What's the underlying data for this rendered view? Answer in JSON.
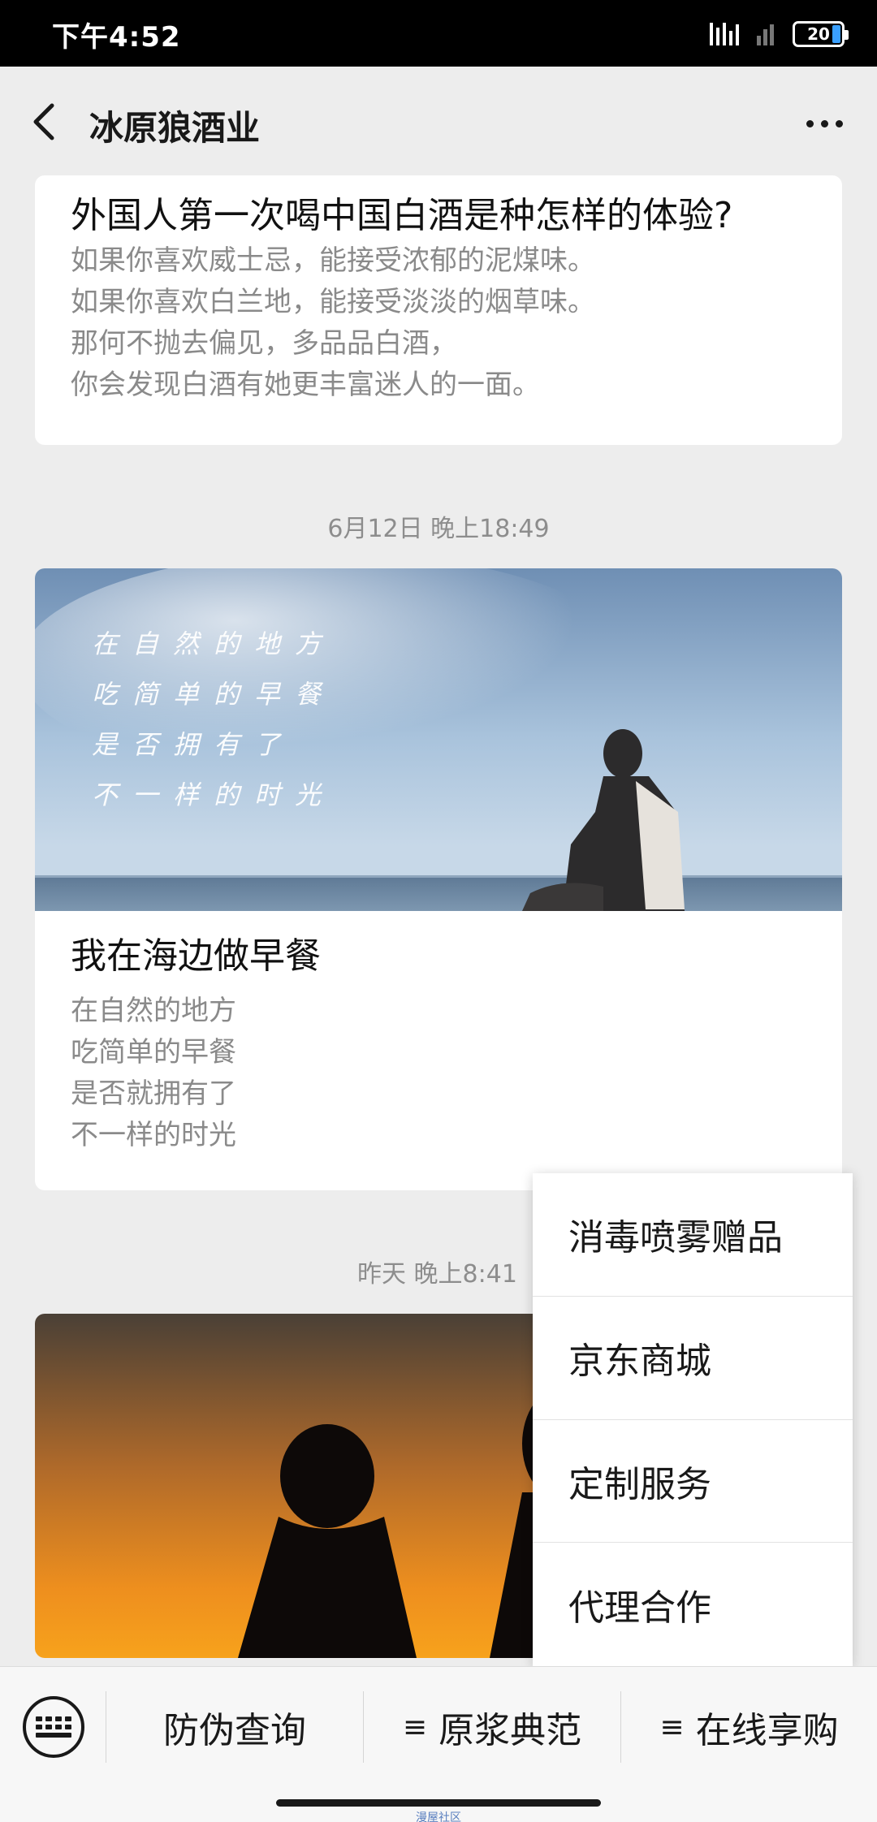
{
  "status_bar": {
    "time": "下午4:52",
    "battery": "20"
  },
  "header": {
    "title": "冰原狼酒业"
  },
  "feed": {
    "articles": [
      {
        "title": "外国人第一次喝中国白酒是种怎样的体验?",
        "desc": [
          "如果你喜欢威士忌，能接受浓郁的泥煤味。",
          "如果你喜欢白兰地，能接受淡淡的烟草味。",
          "那何不抛去偏见，多品品白酒，",
          "你会发现白酒有她更丰富迷人的一面。"
        ]
      },
      {
        "timestamp": "6月12日 晚上18:49",
        "cover_text": [
          "在自然的地方",
          "吃简单的早餐",
          "是否拥有了",
          "不一样的时光"
        ],
        "title": "我在海边做早餐",
        "desc": [
          "在自然的地方",
          "吃简单的早餐",
          "是否就拥有了",
          "不一样的时光"
        ]
      },
      {
        "timestamp": "昨天 晚上8:41"
      }
    ]
  },
  "popup_menu": {
    "items": [
      "消毒喷雾赠品",
      "京东商城",
      "定制服务",
      "代理合作"
    ]
  },
  "bottom_menu": {
    "items": [
      "防伪查询",
      "原浆典范",
      "在线享购"
    ]
  },
  "watermark": "漫屋社区",
  "icons": {
    "back": "chevron-left-icon",
    "more": "more-dots-icon",
    "keyboard": "keyboard-icon",
    "menu": "hamburger-icon"
  }
}
